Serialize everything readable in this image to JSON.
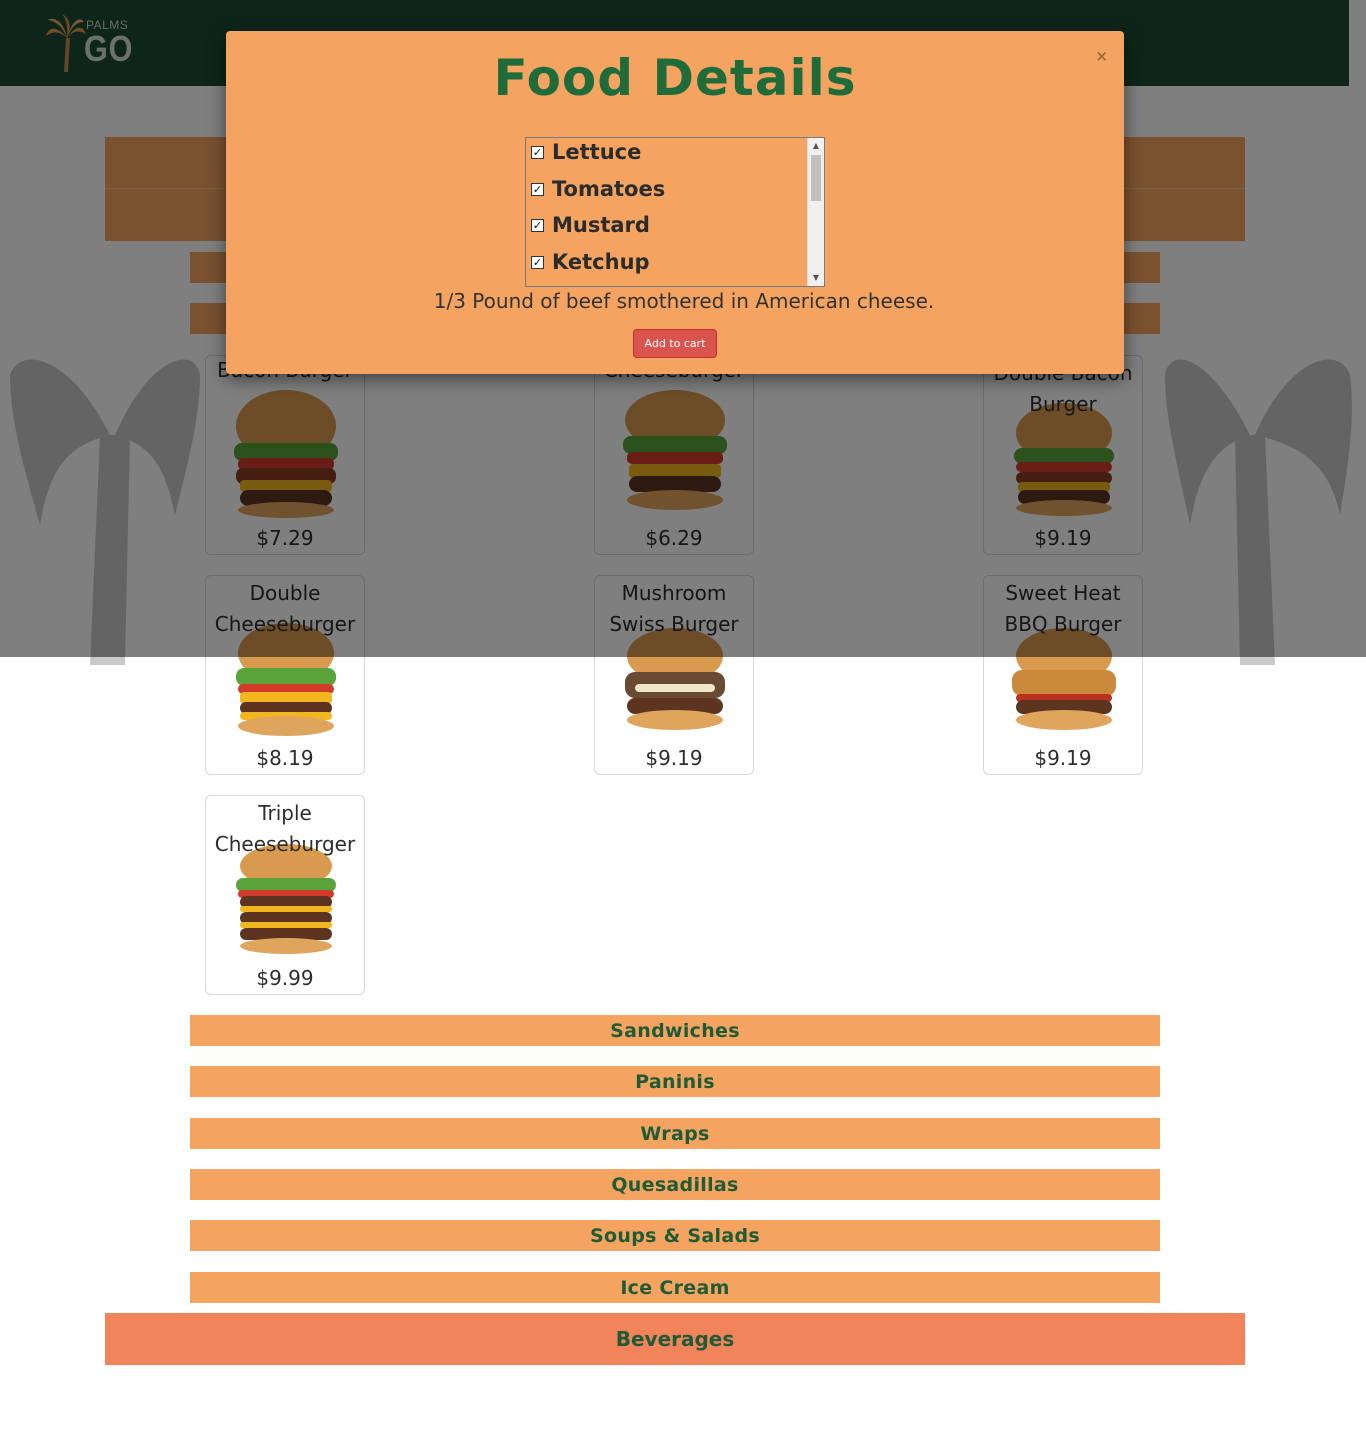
{
  "header": {
    "logo_small": "PALMS",
    "logo_big": "GO"
  },
  "categories": {
    "sandwiches": "Sandwiches",
    "paninis": "Paninis",
    "wraps": "Wraps",
    "quesadillas": "Quesadillas",
    "soups_salads": "Soups & Salads",
    "ice_cream": "Ice Cream",
    "beverages": "Beverages"
  },
  "items": [
    {
      "name": "Bacon Burger",
      "price": "$7.29"
    },
    {
      "name": "Cheeseburger",
      "price": "$6.29"
    },
    {
      "name": "Double Bacon Burger",
      "price": "$9.19"
    },
    {
      "name": "Double Cheeseburger",
      "price": "$8.19"
    },
    {
      "name": "Mushroom Swiss Burger",
      "price": "$9.19"
    },
    {
      "name": "Sweet Heat BBQ Burger",
      "price": "$9.19"
    },
    {
      "name": "Triple Cheeseburger",
      "price": "$9.99"
    }
  ],
  "modal": {
    "title": "Food Details",
    "close": "×",
    "toppings": [
      {
        "label": "Lettuce",
        "checked": true
      },
      {
        "label": "Tomatoes",
        "checked": true
      },
      {
        "label": "Mustard",
        "checked": true
      },
      {
        "label": "Ketchup",
        "checked": true
      }
    ],
    "description": "1/3 Pound of beef smothered in American cheese.",
    "add_to_cart": "Add to cart"
  },
  "colors": {
    "header": "#1b4d33",
    "category_bar": "#f4a460",
    "beverages_bar": "#f2845c",
    "category_text": "#1f5c36",
    "modal_title": "#1f6b3a",
    "add_button": "#d9534f"
  }
}
